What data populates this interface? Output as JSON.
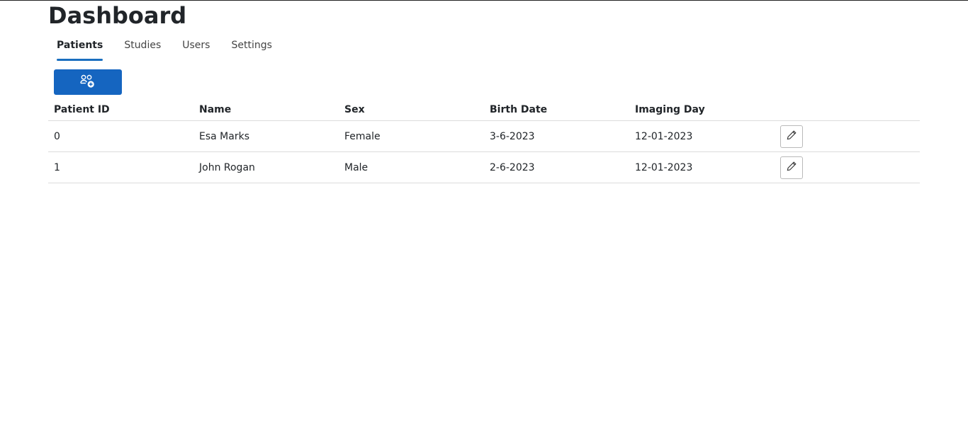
{
  "page": {
    "title": "Dashboard"
  },
  "tabs": [
    {
      "label": "Patients",
      "active": true
    },
    {
      "label": "Studies",
      "active": false
    },
    {
      "label": "Users",
      "active": false
    },
    {
      "label": "Settings",
      "active": false
    }
  ],
  "toolbar": {
    "add_patient_icon": "add-user-icon"
  },
  "table": {
    "columns": [
      "Patient ID",
      "Name",
      "Sex",
      "Birth Date",
      "Imaging Day"
    ],
    "rows": [
      {
        "id": "0",
        "name": "Esa Marks",
        "sex": "Female",
        "birth_date": "3-6-2023",
        "imaging_day": "12-01-2023",
        "action_icon": "pencil-icon"
      },
      {
        "id": "1",
        "name": "John Rogan",
        "sex": "Male",
        "birth_date": "2-6-2023",
        "imaging_day": "12-01-2023",
        "action_icon": "pencil-icon"
      }
    ]
  },
  "colors": {
    "accent": "#1565c0",
    "tab_indicator": "#1a6fbf"
  }
}
